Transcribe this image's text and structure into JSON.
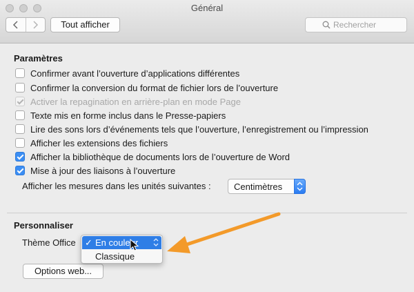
{
  "window": {
    "title": "Général"
  },
  "toolbar": {
    "show_all_label": "Tout afficher",
    "search_placeholder": "Rechercher",
    "back_icon": "chevron-left-icon",
    "forward_icon": "chevron-right-icon"
  },
  "parametres": {
    "title": "Paramètres",
    "options": [
      {
        "label": "Confirmer avant l’ouverture d’applications différentes",
        "checked": false,
        "disabled": false
      },
      {
        "label": "Confirmer la conversion du format de fichier lors de l’ouverture",
        "checked": false,
        "disabled": false
      },
      {
        "label": "Activer la repagination en arrière-plan en mode Page",
        "checked": true,
        "disabled": true
      },
      {
        "label": "Texte mis en forme inclus dans le Presse-papiers",
        "checked": false,
        "disabled": false
      },
      {
        "label": "Lire des sons lors d’événements tels que l’ouverture, l’enregistrement ou l’impression",
        "checked": false,
        "disabled": false
      },
      {
        "label": "Afficher les extensions des fichiers",
        "checked": false,
        "disabled": false
      },
      {
        "label": "Afficher la bibliothèque de documents lors de l’ouverture de Word",
        "checked": true,
        "disabled": false
      },
      {
        "label": "Mise à jour des liaisons à l’ouverture",
        "checked": true,
        "disabled": false
      }
    ],
    "units_label": "Afficher les mesures dans les unités suivantes :",
    "units_value": "Centimètres"
  },
  "personnaliser": {
    "title": "Personnaliser",
    "theme_label": "Thème Office",
    "theme_options": [
      "En couleur",
      "Classique"
    ],
    "theme_selected": "En couleur",
    "check_mark": "✓",
    "web_options_label": "Options web..."
  },
  "colors": {
    "accent": "#2f7ee6",
    "arrow": "#f39a2a",
    "checkbox_checked": "#3b8ef4"
  }
}
